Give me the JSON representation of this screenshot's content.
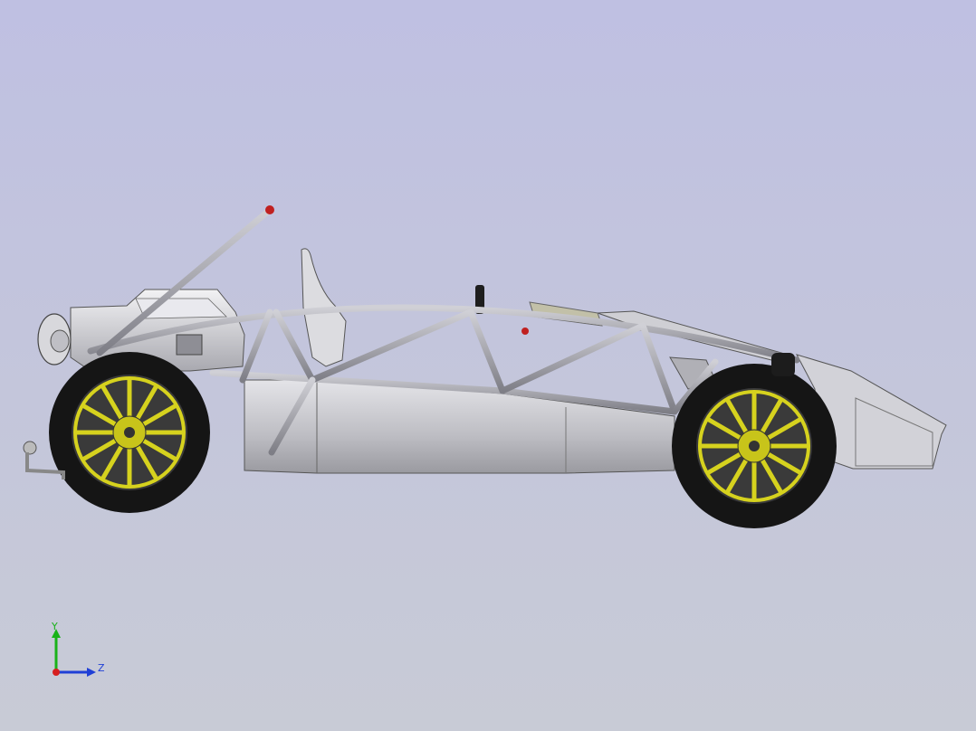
{
  "viewport": {
    "background_top": "#bfc0e2",
    "background_bottom": "#c8cbd6"
  },
  "model": {
    "frame_color": "#a8a8ae",
    "body_color": "#cfcfd4",
    "tire_color": "#1a1a1a",
    "rim_color": "#d6d21e"
  },
  "triad": {
    "y_label": "Y",
    "z_label": "Z",
    "y_color": "#19b219",
    "z_color": "#1f3fd6",
    "x_color": "#d61f1f"
  }
}
